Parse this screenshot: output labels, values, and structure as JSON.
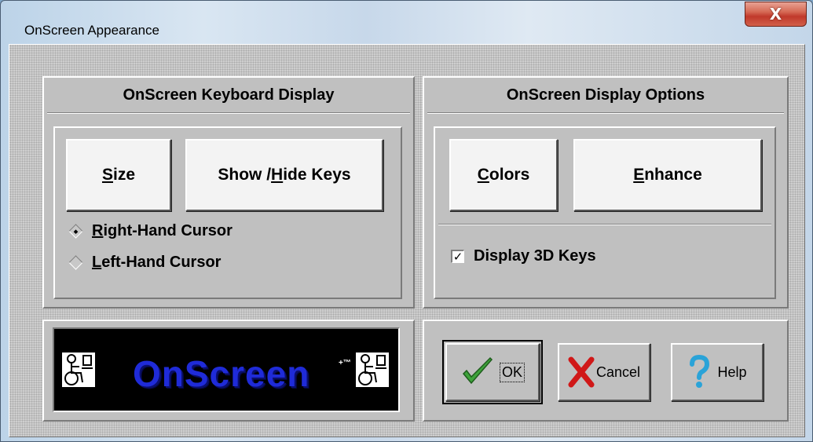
{
  "window": {
    "title": "OnScreen Appearance",
    "close_glyph": "X"
  },
  "keyboard_panel": {
    "title": "OnScreen Keyboard Display",
    "size_button": {
      "accel": "S",
      "rest": "ize"
    },
    "show_hide_button": {
      "pre": "Show / ",
      "accel": "H",
      "rest": "ide Keys"
    },
    "radio_options": [
      {
        "accel": "R",
        "rest": "ight-Hand Cursor",
        "selected": true
      },
      {
        "accel": "L",
        "rest": "eft-Hand Cursor",
        "selected": false
      }
    ]
  },
  "display_panel": {
    "title": "OnScreen Display Options",
    "colors_button": {
      "accel": "C",
      "rest": "olors"
    },
    "enhance_button": {
      "accel": "E",
      "rest": "nhance"
    },
    "checkbox": {
      "label": "Display 3D Keys",
      "checked": true,
      "mark": "✓"
    }
  },
  "logo": {
    "word": "OnScreen",
    "mark": "+™"
  },
  "actions": {
    "ok_label": "OK",
    "cancel_label": "Cancel",
    "help_label": "Help"
  },
  "colors": {
    "ok_check": "#3ea33b",
    "cancel_x": "#d01818",
    "help_q": "#2aa3d8",
    "logo_text": "#1f2bd8"
  }
}
